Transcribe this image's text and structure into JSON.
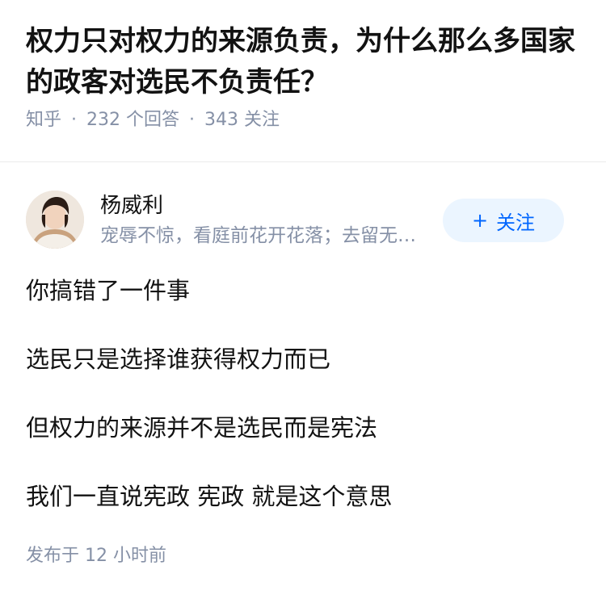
{
  "question": {
    "title": "权力只对权力的来源负责，为什么那么多国家的政客对选民不负责任？",
    "source": "知乎",
    "answers_count_text": "232 个回答",
    "followers_count_text": "343 关注",
    "separator": "·"
  },
  "author": {
    "name": "杨威利",
    "bio": "宠辱不惊，看庭前花开花落；去留无意，望天上云卷云舒",
    "follow_label": "关注",
    "follow_icon": "plus-icon",
    "avatar_icon": "avatar-portrait"
  },
  "answer": {
    "paragraphs": [
      "你搞错了一件事",
      "选民只是选择谁获得权力而已",
      "但权力的来源并不是选民而是宪法",
      "我们一直说宪政 宪政 就是这个意思"
    ],
    "published": "发布于 12 小时前"
  },
  "colors": {
    "primary_text": "#121212",
    "secondary_text": "#8590a6",
    "accent": "#0066ff",
    "follow_bg": "#ebf5ff"
  }
}
